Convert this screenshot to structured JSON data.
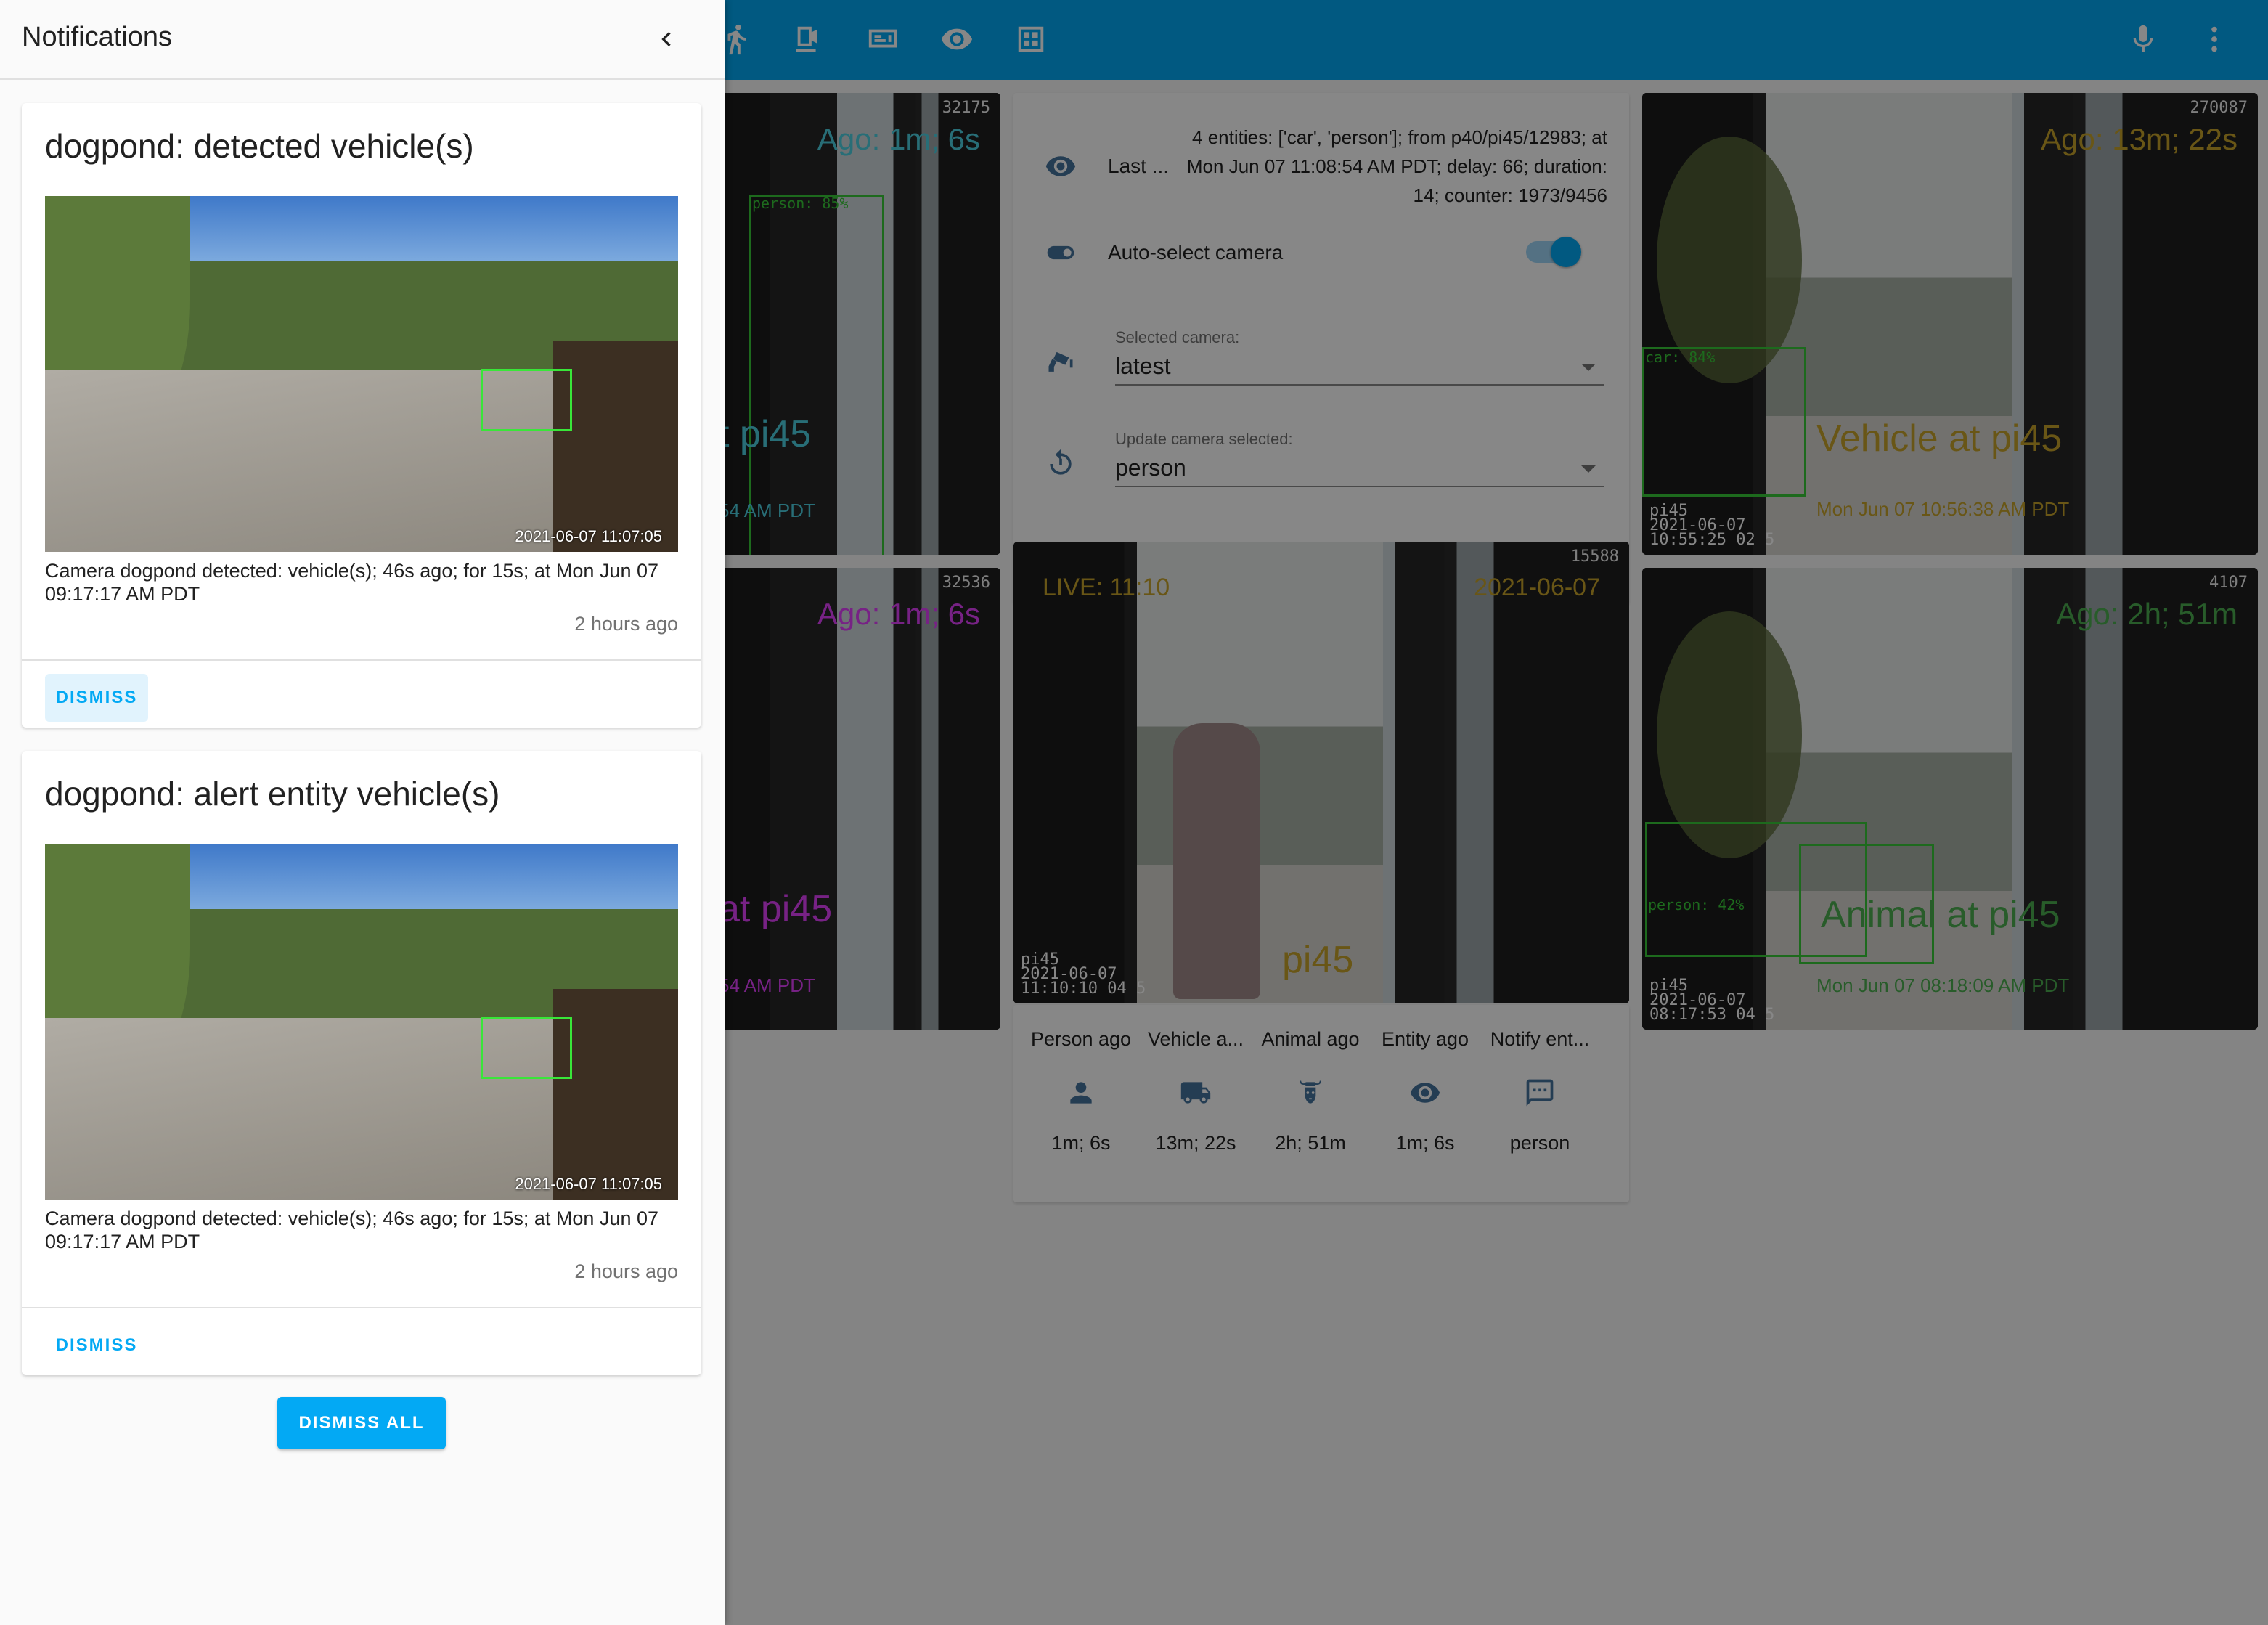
{
  "topbar": {
    "icons": [
      "motion-icon",
      "camera-icon",
      "monitor-icon",
      "eye-icon",
      "calendar-icon",
      "microphone-icon",
      "more-vert-icon"
    ],
    "accent_color": "#03a9f4"
  },
  "cameras": {
    "left_top": {
      "counter": "32175",
      "ago": "Ago: 1m; 6s",
      "title": "t pi45",
      "sub": "54 AM PDT",
      "box_label": "person: 85%"
    },
    "left_bottom": {
      "counter": "32536",
      "ago": "Ago: 1m; 6s",
      "title": "at pi45",
      "sub": "54 AM PDT"
    },
    "right_top": {
      "counter": "270087",
      "ago": "Ago: 13m; 22s",
      "title": "Vehicle at pi45",
      "sub": "Mon Jun 07 10:56:38 AM PDT",
      "stamp": "pi45\n2021-06-07\n10:55:25 02 5",
      "box_label": "car: 84%"
    },
    "right_bottom": {
      "counter": "4107",
      "ago": "Ago: 2h; 51m",
      "title": "Animal at pi45",
      "sub": "Mon Jun 07 08:18:09 AM PDT",
      "stamp": "pi45\n2021-06-07\n08:17:53 04 5",
      "box_label": "person: 42%"
    },
    "live": {
      "counter": "15588",
      "live": "LIVE: 11:10",
      "date": "2021-06-07",
      "name": "pi45",
      "stamp": "pi45\n2021-06-07\n11:10:10 04 5"
    }
  },
  "entities_card": {
    "last_label": "Last ...",
    "last_value": "4 entities: ['car', 'person']; from p40/pi45/12983; at Mon Jun 07 11:08:54 AM PDT; delay: 66; duration: 14; counter: 1973/9456",
    "auto_select_label": "Auto-select camera",
    "auto_select_on": true,
    "selected_camera_label": "Selected camera:",
    "selected_camera_value": "latest",
    "update_label": "Update camera selected:",
    "update_value": "person"
  },
  "glance": [
    {
      "name": "Person ago",
      "icon": "person-icon",
      "state": "1m; 6s"
    },
    {
      "name": "Vehicle a...",
      "icon": "truck-icon",
      "state": "13m; 22s"
    },
    {
      "name": "Animal ago",
      "icon": "cow-icon",
      "state": "2h; 51m"
    },
    {
      "name": "Entity ago",
      "icon": "eye-icon",
      "state": "1m; 6s"
    },
    {
      "name": "Notify ent...",
      "icon": "message-icon",
      "state": "person"
    }
  ],
  "drawer": {
    "title": "Notifications",
    "notifications": [
      {
        "title": "dogpond: detected vehicle(s)",
        "image_stamp": "2021-06-07  11:07:05",
        "message": "Camera dogpond detected: vehicle(s); 46s ago; for 15s; at Mon Jun 07 09:17:17 AM PDT",
        "time": "2 hours ago",
        "dismiss": "DISMISS"
      },
      {
        "title": "dogpond: alert entity vehicle(s)",
        "image_stamp": "2021-06-07  11:07:05",
        "message": "Camera dogpond detected: vehicle(s); 46s ago; for 15s; at Mon Jun 07 09:17:17 AM PDT",
        "time": "2 hours ago",
        "dismiss": "DISMISS"
      }
    ],
    "dismiss_all": "DISMISS ALL"
  }
}
